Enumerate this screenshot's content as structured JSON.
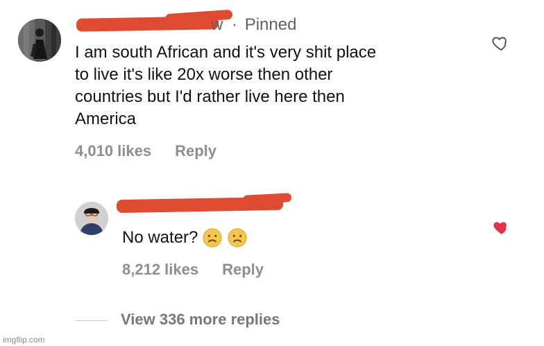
{
  "comment": {
    "username_visible_fragment": "w",
    "separator": "·",
    "pinned_label": "Pinned",
    "text_lines": [
      "I am south African and it's very shit place",
      "to live it's like 20x worse then other",
      "countries but I'd rather live here then",
      "America"
    ],
    "likes": "4,010 likes",
    "reply_label": "Reply",
    "heart_icon": "heart-outline-icon",
    "heart_state": "not-liked"
  },
  "reply": {
    "text": "No water?",
    "emojis": [
      "frowning-face-emoji",
      "frowning-face-emoji"
    ],
    "likes": "8,212 likes",
    "reply_label": "Reply",
    "heart_icon": "heart-filled-icon",
    "heart_state": "liked",
    "heart_color": "#e0344d"
  },
  "thread": {
    "view_more_label": "View 336 more replies"
  },
  "watermark": {
    "text": "imgflip.com"
  },
  "colors": {
    "redaction": "#df4a32",
    "primary_text": "#111111",
    "secondary_text": "#8e8e8e",
    "like_active": "#e0344d"
  }
}
